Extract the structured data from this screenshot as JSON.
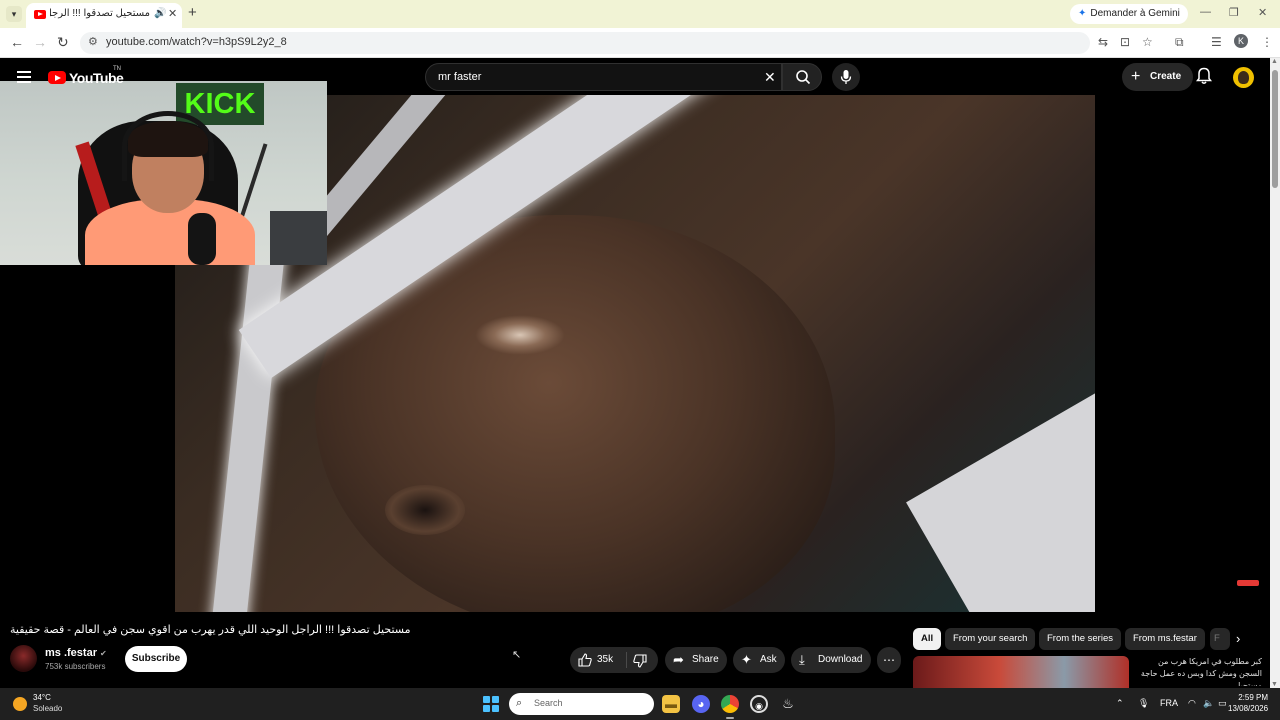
{
  "browser": {
    "tab_title": "مستحيل تصدقوا !!! الرجل الو",
    "tab_close": "✕",
    "new_tab": "+",
    "gemini_label": "Demander à Gemini",
    "url": "youtube.com/watch?v=h3pS9L2y2_8",
    "profile_initial": "K"
  },
  "youtube": {
    "logo_text": "YouTube",
    "logo_tm": "TN",
    "search_query": "mr faster",
    "create_label": "Create",
    "webcam_sign": "KICK",
    "video_title": "مستحيل تصدقوا !!! الراجل الوحيد اللي قدر يهرب من اقوي سجن في العالم - قصة حقيقية",
    "channel": {
      "name": "ms .festar",
      "subscribers": "753k subscribers",
      "subscribe_label": "Subscribe"
    },
    "actions": {
      "likes": "35k",
      "share": "Share",
      "ask": "Ask",
      "download": "Download"
    },
    "chips": [
      "All",
      "From your search",
      "From the series",
      "From ms.festar",
      "F"
    ],
    "rec_title": "كبر مطلوب في امريكا هرب من السجن ومش كدا وبس ده عمل حاجة مستحيل"
  },
  "taskbar": {
    "temperature": "34°C",
    "condition": "Soleado",
    "search_placeholder": "Search",
    "language": "FRA",
    "time": "2:59 PM",
    "date": "13/08/2026"
  },
  "colors": {
    "yt_red": "#ff0000",
    "kick_green": "#53fc18",
    "chrome_tabbar": "#f1f3d5",
    "taskbar": "#202020"
  }
}
